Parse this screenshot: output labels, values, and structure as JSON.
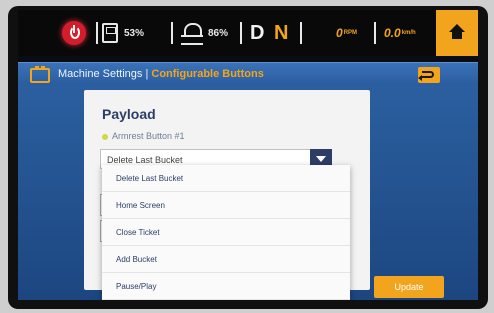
{
  "status_bar": {
    "fuel_pct": "53%",
    "def_pct": "86%",
    "gear_drive": "D",
    "gear_neutral": "N",
    "rpm_value": "0",
    "rpm_unit": "RPM",
    "speed_value": "0.0",
    "speed_unit": "km/h"
  },
  "title_bar": {
    "section": "Machine Settings",
    "separator": " | ",
    "page": "Configurable Buttons"
  },
  "panel": {
    "heading": "Payload",
    "field_label": "Armrest Button #1",
    "selected_value": "Delete Last Bucket",
    "update_label": "Update"
  },
  "dropdown": {
    "options": [
      "Delete Last Bucket",
      "Home Screen",
      "Close Ticket",
      "Add Bucket",
      "Pause/Play"
    ]
  },
  "colors": {
    "accent": "#f2a51c",
    "power": "#d41c2b",
    "panel_blue": "#2b5f9f",
    "text_navy": "#2c3e66"
  },
  "icons": [
    "power-icon",
    "fuel-icon",
    "def-icon",
    "home-icon",
    "machine-icon",
    "back-icon",
    "chevron-down-icon"
  ]
}
